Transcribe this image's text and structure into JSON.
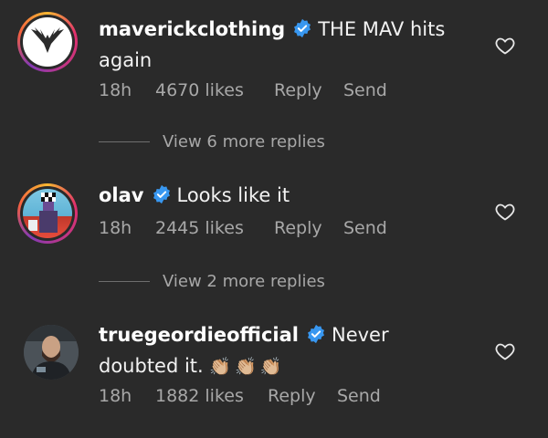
{
  "comments": [
    {
      "username": "maverickclothing",
      "text": "THE MAV hits again",
      "time": "18h",
      "likes": "4670 likes",
      "reply": "Reply",
      "send": "Send"
    },
    {
      "username": "olav",
      "text": "Looks like it",
      "time": "18h",
      "likes": "2445 likes",
      "reply": "Reply",
      "send": "Send"
    },
    {
      "username": "truegeordieofficial",
      "text": "Never doubted it.",
      "emojis": "👏🏼👏🏼👏🏼",
      "time": "18h",
      "likes": "1882 likes",
      "reply": "Reply",
      "send": "Send"
    }
  ],
  "view_replies": [
    {
      "label": "View 6 more replies"
    },
    {
      "label": "View 2 more replies"
    }
  ],
  "colors": {
    "background": "#2a2a2a",
    "verified": "#3897f0",
    "muted_text": "#a8a8a8"
  }
}
